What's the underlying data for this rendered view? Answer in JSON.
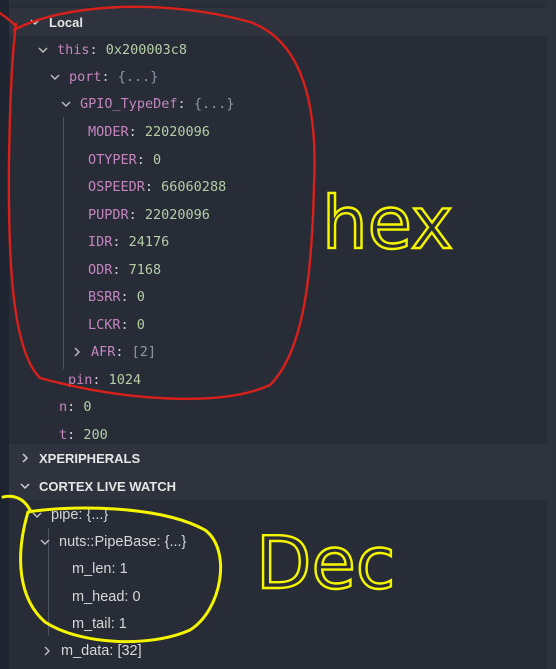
{
  "local": {
    "header": "Local",
    "this_key": "this",
    "this_val": "0x200003c8",
    "port_key": "port",
    "port_val": "{...}",
    "gpio_key": "GPIO_TypeDef",
    "gpio_val": "{...}",
    "registers": [
      {
        "name": "MODER",
        "value": "22020096"
      },
      {
        "name": "OTYPER",
        "value": "0"
      },
      {
        "name": "OSPEEDR",
        "value": "66060288"
      },
      {
        "name": "PUPDR",
        "value": "22020096"
      },
      {
        "name": "IDR",
        "value": "24176"
      },
      {
        "name": "ODR",
        "value": "7168"
      },
      {
        "name": "BSRR",
        "value": "0"
      },
      {
        "name": "LCKR",
        "value": "0"
      }
    ],
    "afr_key": "AFR",
    "afr_val": "[2]",
    "pin_key": "pin",
    "pin_val": "1024",
    "n_key": "n",
    "n_val": "0",
    "t_key": "t",
    "t_val": "200"
  },
  "xperipherals": {
    "header": "XPERIPHERALS"
  },
  "live_watch": {
    "header": "CORTEX LIVE WATCH",
    "pipe_key": "pipe",
    "pipe_val": "{...}",
    "base_key": "nuts::PipeBase",
    "base_val": "{...}",
    "m_len_key": "m_len",
    "m_len_val": "1",
    "m_head_key": "m_head",
    "m_head_val": "0",
    "m_tail_key": "m_tail",
    "m_tail_val": "1",
    "m_data_key": "m_data",
    "m_data_val": "[32]"
  },
  "annotations": {
    "hex": "hex",
    "dec": "Dec",
    "red": "#d9201a",
    "yellow": "#f5f500"
  }
}
